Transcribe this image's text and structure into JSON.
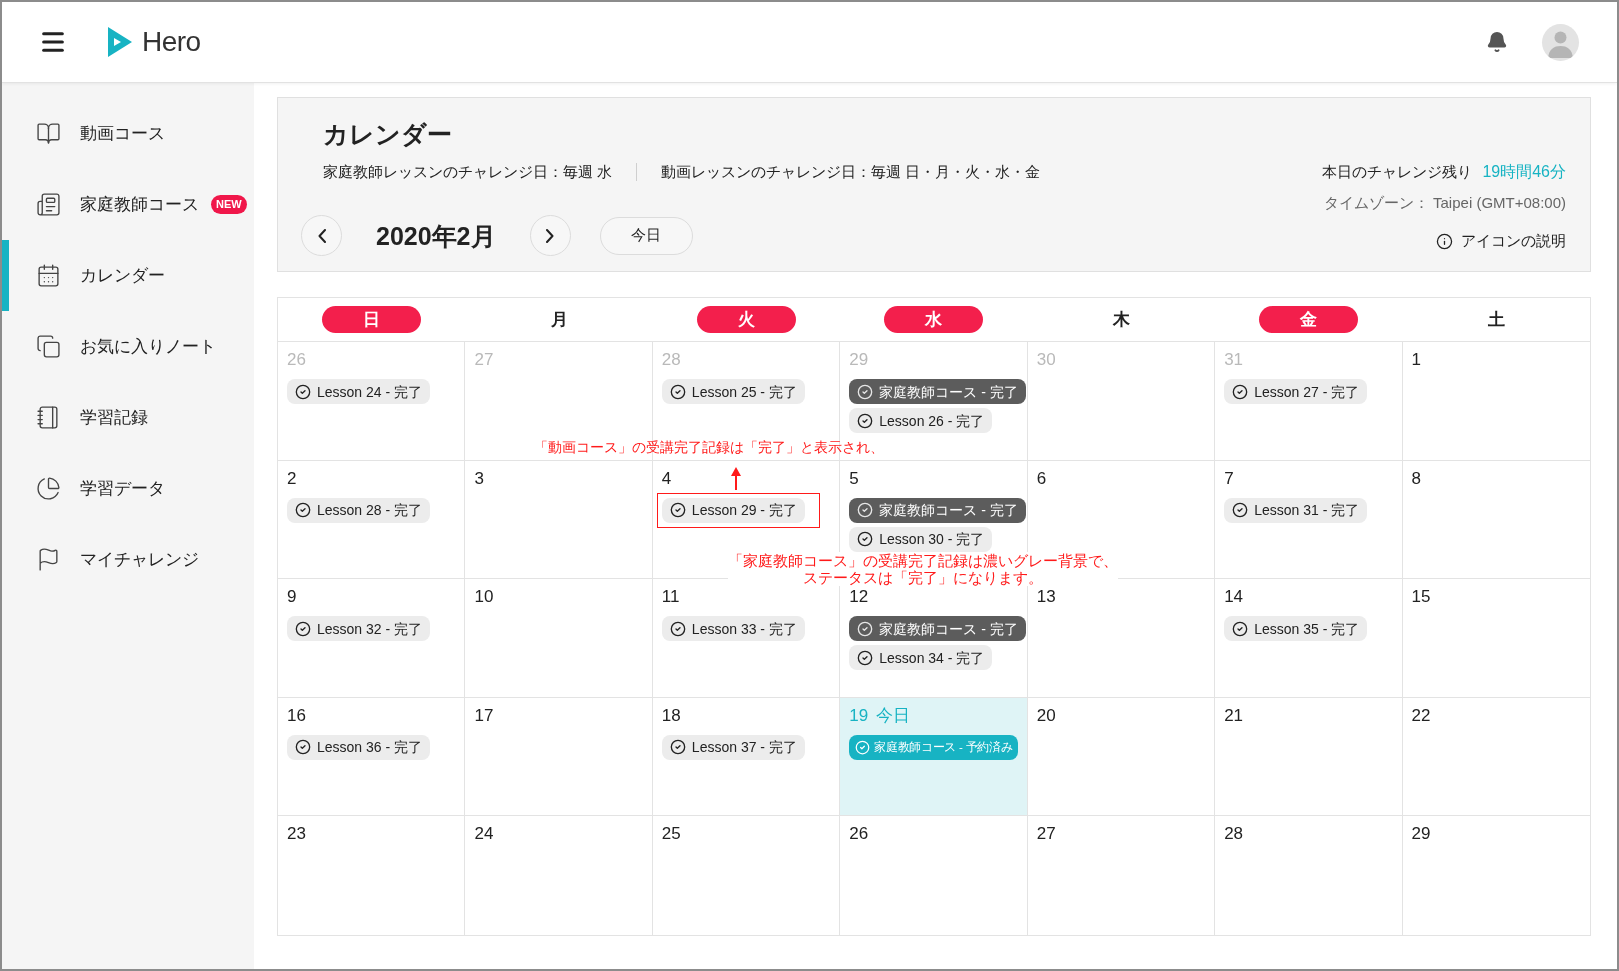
{
  "header": {
    "logo": "Hero"
  },
  "sidebar": {
    "items": [
      {
        "label": "動画コース",
        "selected": false
      },
      {
        "label": "家庭教師コース",
        "selected": false,
        "badge": "NEW"
      },
      {
        "label": "カレンダー",
        "selected": true
      },
      {
        "label": "お気に入りノート",
        "selected": false
      },
      {
        "label": "学習記録",
        "selected": false
      },
      {
        "label": "学習データ",
        "selected": false
      },
      {
        "label": "マイチャレンジ",
        "selected": false
      }
    ]
  },
  "calendar_panel": {
    "title": "カレンダー",
    "challenge_days": [
      "家庭教師レッスンのチャレンジ日：毎週 水",
      "動画レッスンのチャレンジ日：毎週 日・月・火・水・金"
    ],
    "remaining": {
      "label": "本日のチャレンジ残り",
      "value": "19時間46分"
    },
    "timezone": "タイムゾーン： Taipei (GMT+08:00)",
    "icon_legend": "アイコンの説明",
    "month": "2020年2月",
    "today_button": "今日"
  },
  "calendar": {
    "weekdays": [
      {
        "label": "日",
        "highlighted": true
      },
      {
        "label": "月",
        "highlighted": false
      },
      {
        "label": "火",
        "highlighted": true
      },
      {
        "label": "水",
        "highlighted": true
      },
      {
        "label": "木",
        "highlighted": false
      },
      {
        "label": "金",
        "highlighted": true
      },
      {
        "label": "土",
        "highlighted": false
      }
    ],
    "weeks": [
      [
        {
          "day": "26",
          "outside_month": true,
          "today": false,
          "events": [
            {
              "kind": "lesson",
              "label": "Lesson 24 - 完了",
              "outlined": false
            }
          ]
        },
        {
          "day": "27",
          "outside_month": true,
          "today": false
        },
        {
          "day": "28",
          "outside_month": true,
          "today": false,
          "events": [
            {
              "kind": "lesson",
              "label": "Lesson 25 - 完了",
              "outlined": false
            }
          ]
        },
        {
          "day": "29",
          "outside_month": true,
          "today": false,
          "events": [
            {
              "kind": "tutor",
              "label": "家庭教師コース - 完了",
              "outlined": false
            },
            {
              "kind": "lesson",
              "label": "Lesson 26 - 完了",
              "outlined": false
            }
          ]
        },
        {
          "day": "30",
          "outside_month": true,
          "today": false
        },
        {
          "day": "31",
          "outside_month": true,
          "today": false,
          "events": [
            {
              "kind": "lesson",
              "label": "Lesson 27 - 完了",
              "outlined": false
            }
          ]
        },
        {
          "day": "1",
          "outside_month": false,
          "today": false
        }
      ],
      [
        {
          "day": "2",
          "outside_month": false,
          "today": false,
          "events": [
            {
              "kind": "lesson",
              "label": "Lesson 28 - 完了",
              "outlined": false
            }
          ]
        },
        {
          "day": "3",
          "outside_month": false,
          "today": false
        },
        {
          "day": "4",
          "outside_month": false,
          "today": false,
          "events": [
            {
              "kind": "lesson",
              "label": "Lesson 29 - 完了",
              "outlined": true
            }
          ]
        },
        {
          "day": "5",
          "outside_month": false,
          "today": false,
          "events": [
            {
              "kind": "tutor",
              "label": "家庭教師コース - 完了",
              "outlined": false
            },
            {
              "kind": "lesson",
              "label": "Lesson 30 - 完了",
              "outlined": false
            }
          ]
        },
        {
          "day": "6",
          "outside_month": false,
          "today": false
        },
        {
          "day": "7",
          "outside_month": false,
          "today": false,
          "events": [
            {
              "kind": "lesson",
              "label": "Lesson 31 - 完了",
              "outlined": false
            }
          ]
        },
        {
          "day": "8",
          "outside_month": false,
          "today": false
        }
      ],
      [
        {
          "day": "9",
          "outside_month": false,
          "today": false,
          "events": [
            {
              "kind": "lesson",
              "label": "Lesson 32 - 完了",
              "outlined": false
            }
          ]
        },
        {
          "day": "10",
          "outside_month": false,
          "today": false
        },
        {
          "day": "11",
          "outside_month": false,
          "today": false,
          "events": [
            {
              "kind": "lesson",
              "label": "Lesson 33 - 完了",
              "outlined": false
            }
          ]
        },
        {
          "day": "12",
          "outside_month": false,
          "today": false,
          "events": [
            {
              "kind": "tutor",
              "label": "家庭教師コース - 完了",
              "outlined": false
            },
            {
              "kind": "lesson",
              "label": "Lesson 34 - 完了",
              "outlined": false
            }
          ]
        },
        {
          "day": "13",
          "outside_month": false,
          "today": false
        },
        {
          "day": "14",
          "outside_month": false,
          "today": false,
          "events": [
            {
              "kind": "lesson",
              "label": "Lesson 35 - 完了",
              "outlined": false
            }
          ]
        },
        {
          "day": "15",
          "outside_month": false,
          "today": false
        }
      ],
      [
        {
          "day": "16",
          "outside_month": false,
          "today": false,
          "events": [
            {
              "kind": "lesson",
              "label": "Lesson 36 - 完了",
              "outlined": false
            }
          ]
        },
        {
          "day": "17",
          "outside_month": false,
          "today": false
        },
        {
          "day": "18",
          "outside_month": false,
          "today": false,
          "events": [
            {
              "kind": "lesson",
              "label": "Lesson 37 - 完了",
              "outlined": false
            }
          ]
        },
        {
          "day": "19",
          "outside_month": false,
          "today": true,
          "today_label": "今日",
          "events": [
            {
              "kind": "booked",
              "label": "家庭教師コース - 予約済み",
              "outlined": false
            }
          ]
        },
        {
          "day": "20",
          "outside_month": false,
          "today": false
        },
        {
          "day": "21",
          "outside_month": false,
          "today": false
        },
        {
          "day": "22",
          "outside_month": false,
          "today": false
        }
      ],
      [
        {
          "day": "23",
          "outside_month": false,
          "today": false
        },
        {
          "day": "24",
          "outside_month": false,
          "today": false
        },
        {
          "day": "25",
          "outside_month": false,
          "today": false
        },
        {
          "day": "26",
          "outside_month": false,
          "today": false
        },
        {
          "day": "27",
          "outside_month": false,
          "today": false
        },
        {
          "day": "28",
          "outside_month": false,
          "today": false
        },
        {
          "day": "29",
          "outside_month": false,
          "today": false
        }
      ]
    ]
  },
  "annotations": [
    {
      "lines": [
        "「動画コース」の受講完了記録は「完了」と表示され、"
      ],
      "arrow": true
    },
    {
      "lines": [
        "「家庭教師コース」の受講完了記録は濃いグレー背景で、",
        "ステータスは「完了」になります。"
      ],
      "arrow": false
    }
  ]
}
